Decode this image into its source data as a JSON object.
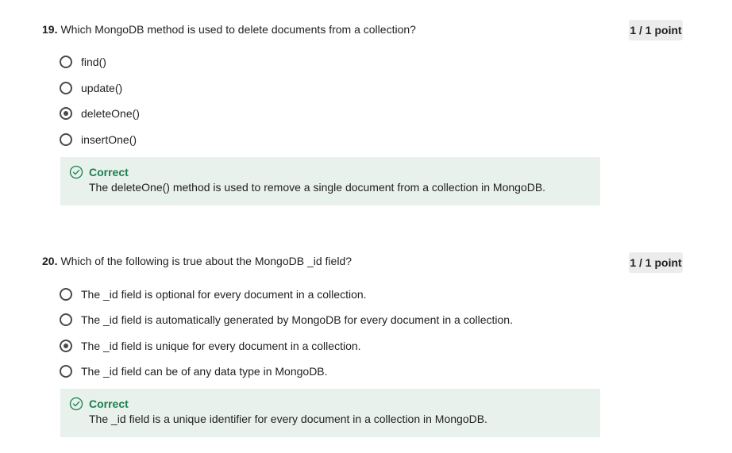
{
  "questions": [
    {
      "number": "19.",
      "text": "Which MongoDB method is used to delete documents from a collection?",
      "points": "1 / 1 point",
      "options": [
        {
          "label": "find()",
          "selected": false
        },
        {
          "label": "update()",
          "selected": false
        },
        {
          "label": "deleteOne()",
          "selected": true
        },
        {
          "label": "insertOne()",
          "selected": false
        }
      ],
      "feedback": {
        "status": "Correct",
        "explanation": "The deleteOne() method is used to remove a single document from a collection in MongoDB.",
        "icon": "check-circle-icon"
      }
    },
    {
      "number": "20.",
      "text": "Which of the following is true about the MongoDB _id field?",
      "points": "1 / 1 point",
      "options": [
        {
          "label": "The _id field is optional for every document in a collection.",
          "selected": false
        },
        {
          "label": "The _id field is automatically generated by MongoDB for every document in a collection.",
          "selected": false
        },
        {
          "label": "The _id field is unique for every document in a collection.",
          "selected": true
        },
        {
          "label": "The _id field can be of any data type in MongoDB.",
          "selected": false
        }
      ],
      "feedback": {
        "status": "Correct",
        "explanation": "The _id field is a unique identifier for every document in a collection in MongoDB.",
        "icon": "check-circle-icon"
      }
    }
  ],
  "colors": {
    "correct_text": "#1b7f4c",
    "feedback_bg": "#e8f1ec",
    "badge_bg": "#ececec"
  }
}
